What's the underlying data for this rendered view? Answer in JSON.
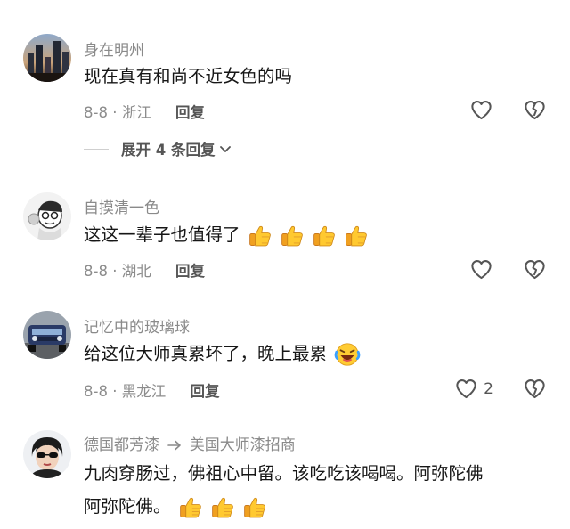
{
  "comments": [
    {
      "user": "身在明州",
      "text": "现在真有和尚不近女色的吗",
      "date": "8-8",
      "location": "浙江",
      "reply_label": "回复",
      "like_count": "",
      "expand_label": "展开 4 条回复"
    },
    {
      "user": "自摸清一色",
      "text": "这这一辈子也值得了",
      "date": "8-8",
      "location": "湖北",
      "reply_label": "回复",
      "like_count": ""
    },
    {
      "user": "记忆中的玻璃球",
      "text": "给这位大师真累坏了，晚上最累",
      "date": "8-8",
      "location": "黑龙江",
      "reply_label": "回复",
      "like_count": "2"
    },
    {
      "user": "德国都芳漆",
      "reply_to": "美国大师漆招商",
      "text_line1": "九肉穿肠过，佛祖心中留。该吃吃该喝喝。阿弥陀佛",
      "text_line2": "阿弥陀佛。"
    }
  ],
  "icons": {
    "like": "heart-outline-icon",
    "dislike": "broken-heart-icon",
    "expand": "chevron-down-icon",
    "arrow": "arrow-right-icon",
    "thumbs": "thumbs-up-emoji",
    "laugh": "tears-of-joy-emoji"
  },
  "colors": {
    "username": "#8a8a8a",
    "text": "#161616",
    "meta": "#8c8c8c",
    "action": "#555555"
  }
}
